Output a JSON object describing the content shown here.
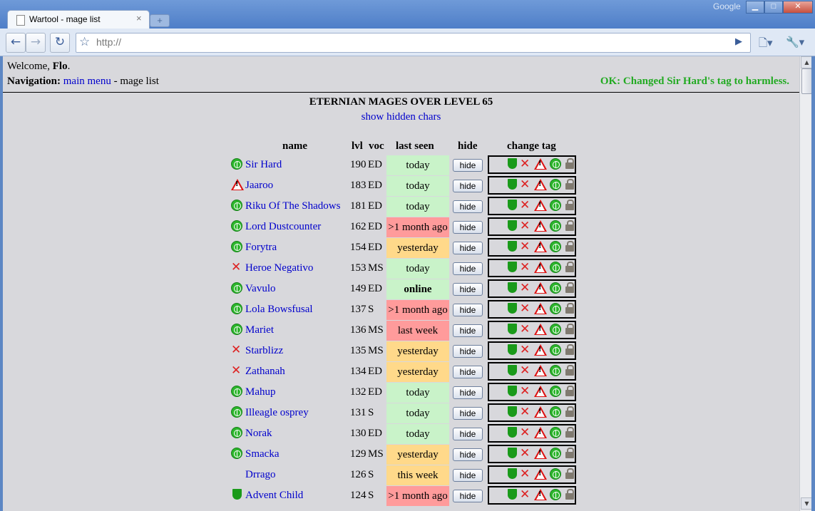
{
  "browser": {
    "tab_title": "Wartool - mage list",
    "tab_close": "×",
    "new_tab": "+",
    "google_label": "Google",
    "url": "http://"
  },
  "page": {
    "welcome_prefix": "Welcome,",
    "user": "Flo",
    "nav_label": "Navigation:",
    "nav_link": "main menu",
    "nav_sep": "-",
    "nav_current": "mage list",
    "ok_message": "OK: Changed Sir Hard's tag to harmless.",
    "heading": "ETERNIAN MAGES OVER LEVEL 65",
    "show_hidden": "show hidden chars",
    "columns": {
      "name": "name",
      "lvl": "lvl",
      "voc": "voc",
      "last_seen": "last seen",
      "hide": "hide",
      "change_tag": "change tag"
    },
    "hide_label": "hide"
  },
  "colors": {
    "seen_today": "#c9f3c9",
    "seen_recent": "#ffd98a",
    "seen_old": "#ff9b9b"
  },
  "rows": [
    {
      "tag": "peace",
      "name": "Sir Hard",
      "lvl": "190",
      "voc": "ED",
      "seen": "today",
      "seen_class": "today"
    },
    {
      "tag": "warn",
      "name": "Jaaroo",
      "lvl": "183",
      "voc": "ED",
      "seen": "today",
      "seen_class": "today"
    },
    {
      "tag": "peace",
      "name": "Riku Of The Shadows",
      "lvl": "181",
      "voc": "ED",
      "seen": "today",
      "seen_class": "today"
    },
    {
      "tag": "peace",
      "name": "Lord Dustcounter",
      "lvl": "162",
      "voc": "ED",
      "seen": ">1 month ago",
      "seen_class": "old"
    },
    {
      "tag": "peace",
      "name": "Forytra",
      "lvl": "154",
      "voc": "ED",
      "seen": "yesterday",
      "seen_class": "recent"
    },
    {
      "tag": "cross",
      "name": "Heroe Negativo",
      "lvl": "153",
      "voc": "MS",
      "seen": "today",
      "seen_class": "today"
    },
    {
      "tag": "peace",
      "name": "Vavulo",
      "lvl": "149",
      "voc": "ED",
      "seen": "online",
      "seen_class": "online"
    },
    {
      "tag": "peace",
      "name": "Lola Bowsfusal",
      "lvl": "137",
      "voc": "S",
      "seen": ">1 month ago",
      "seen_class": "old"
    },
    {
      "tag": "peace",
      "name": "Mariet",
      "lvl": "136",
      "voc": "MS",
      "seen": "last week",
      "seen_class": "old"
    },
    {
      "tag": "cross",
      "name": "Starblizz",
      "lvl": "135",
      "voc": "MS",
      "seen": "yesterday",
      "seen_class": "recent"
    },
    {
      "tag": "cross",
      "name": "Zathanah",
      "lvl": "134",
      "voc": "ED",
      "seen": "yesterday",
      "seen_class": "recent"
    },
    {
      "tag": "peace",
      "name": "Mahup",
      "lvl": "132",
      "voc": "ED",
      "seen": "today",
      "seen_class": "today"
    },
    {
      "tag": "peace",
      "name": "Illeagle osprey",
      "lvl": "131",
      "voc": "S",
      "seen": "today",
      "seen_class": "today"
    },
    {
      "tag": "peace",
      "name": "Norak",
      "lvl": "130",
      "voc": "ED",
      "seen": "today",
      "seen_class": "today"
    },
    {
      "tag": "peace",
      "name": "Smacka",
      "lvl": "129",
      "voc": "MS",
      "seen": "yesterday",
      "seen_class": "recent"
    },
    {
      "tag": "none",
      "name": "Drrago",
      "lvl": "126",
      "voc": "S",
      "seen": "this week",
      "seen_class": "recent"
    },
    {
      "tag": "shield",
      "name": "Advent Child",
      "lvl": "124",
      "voc": "S",
      "seen": ">1 month ago",
      "seen_class": "old"
    }
  ]
}
